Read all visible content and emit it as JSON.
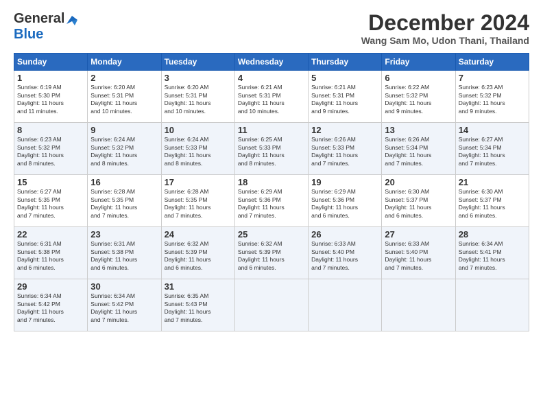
{
  "logo": {
    "line1": "General",
    "line2": "Blue"
  },
  "header": {
    "month": "December 2024",
    "location": "Wang Sam Mo, Udon Thani, Thailand"
  },
  "weekdays": [
    "Sunday",
    "Monday",
    "Tuesday",
    "Wednesday",
    "Thursday",
    "Friday",
    "Saturday"
  ],
  "weeks": [
    [
      {
        "day": "1",
        "sr": "6:19 AM",
        "ss": "5:30 PM",
        "dl": "11 hours and 11 minutes."
      },
      {
        "day": "2",
        "sr": "6:20 AM",
        "ss": "5:31 PM",
        "dl": "11 hours and 10 minutes."
      },
      {
        "day": "3",
        "sr": "6:20 AM",
        "ss": "5:31 PM",
        "dl": "11 hours and 10 minutes."
      },
      {
        "day": "4",
        "sr": "6:21 AM",
        "ss": "5:31 PM",
        "dl": "11 hours and 10 minutes."
      },
      {
        "day": "5",
        "sr": "6:21 AM",
        "ss": "5:31 PM",
        "dl": "11 hours and 9 minutes."
      },
      {
        "day": "6",
        "sr": "6:22 AM",
        "ss": "5:32 PM",
        "dl": "11 hours and 9 minutes."
      },
      {
        "day": "7",
        "sr": "6:23 AM",
        "ss": "5:32 PM",
        "dl": "11 hours and 9 minutes."
      }
    ],
    [
      {
        "day": "8",
        "sr": "6:23 AM",
        "ss": "5:32 PM",
        "dl": "11 hours and 8 minutes."
      },
      {
        "day": "9",
        "sr": "6:24 AM",
        "ss": "5:32 PM",
        "dl": "11 hours and 8 minutes."
      },
      {
        "day": "10",
        "sr": "6:24 AM",
        "ss": "5:33 PM",
        "dl": "11 hours and 8 minutes."
      },
      {
        "day": "11",
        "sr": "6:25 AM",
        "ss": "5:33 PM",
        "dl": "11 hours and 8 minutes."
      },
      {
        "day": "12",
        "sr": "6:26 AM",
        "ss": "5:33 PM",
        "dl": "11 hours and 7 minutes."
      },
      {
        "day": "13",
        "sr": "6:26 AM",
        "ss": "5:34 PM",
        "dl": "11 hours and 7 minutes."
      },
      {
        "day": "14",
        "sr": "6:27 AM",
        "ss": "5:34 PM",
        "dl": "11 hours and 7 minutes."
      }
    ],
    [
      {
        "day": "15",
        "sr": "6:27 AM",
        "ss": "5:35 PM",
        "dl": "11 hours and 7 minutes."
      },
      {
        "day": "16",
        "sr": "6:28 AM",
        "ss": "5:35 PM",
        "dl": "11 hours and 7 minutes."
      },
      {
        "day": "17",
        "sr": "6:28 AM",
        "ss": "5:35 PM",
        "dl": "11 hours and 7 minutes."
      },
      {
        "day": "18",
        "sr": "6:29 AM",
        "ss": "5:36 PM",
        "dl": "11 hours and 7 minutes."
      },
      {
        "day": "19",
        "sr": "6:29 AM",
        "ss": "5:36 PM",
        "dl": "11 hours and 6 minutes."
      },
      {
        "day": "20",
        "sr": "6:30 AM",
        "ss": "5:37 PM",
        "dl": "11 hours and 6 minutes."
      },
      {
        "day": "21",
        "sr": "6:30 AM",
        "ss": "5:37 PM",
        "dl": "11 hours and 6 minutes."
      }
    ],
    [
      {
        "day": "22",
        "sr": "6:31 AM",
        "ss": "5:38 PM",
        "dl": "11 hours and 6 minutes."
      },
      {
        "day": "23",
        "sr": "6:31 AM",
        "ss": "5:38 PM",
        "dl": "11 hours and 6 minutes."
      },
      {
        "day": "24",
        "sr": "6:32 AM",
        "ss": "5:39 PM",
        "dl": "11 hours and 6 minutes."
      },
      {
        "day": "25",
        "sr": "6:32 AM",
        "ss": "5:39 PM",
        "dl": "11 hours and 6 minutes."
      },
      {
        "day": "26",
        "sr": "6:33 AM",
        "ss": "5:40 PM",
        "dl": "11 hours and 7 minutes."
      },
      {
        "day": "27",
        "sr": "6:33 AM",
        "ss": "5:40 PM",
        "dl": "11 hours and 7 minutes."
      },
      {
        "day": "28",
        "sr": "6:34 AM",
        "ss": "5:41 PM",
        "dl": "11 hours and 7 minutes."
      }
    ],
    [
      {
        "day": "29",
        "sr": "6:34 AM",
        "ss": "5:42 PM",
        "dl": "11 hours and 7 minutes."
      },
      {
        "day": "30",
        "sr": "6:34 AM",
        "ss": "5:42 PM",
        "dl": "11 hours and 7 minutes."
      },
      {
        "day": "31",
        "sr": "6:35 AM",
        "ss": "5:43 PM",
        "dl": "11 hours and 7 minutes."
      },
      null,
      null,
      null,
      null
    ]
  ],
  "labels": {
    "sunrise": "Sunrise:",
    "sunset": "Sunset:",
    "daylight": "Daylight:"
  }
}
